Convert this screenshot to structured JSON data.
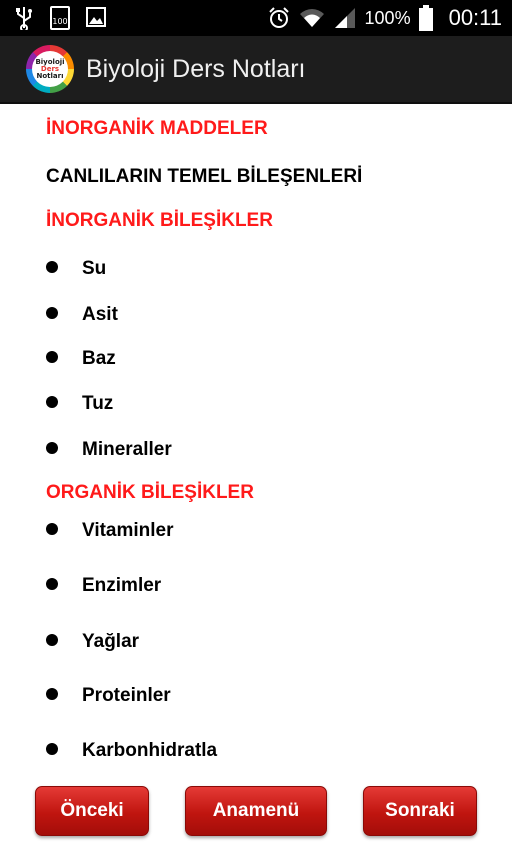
{
  "status_bar": {
    "battery_icon_text": "100",
    "battery_percent": "100%",
    "time": "00:11",
    "icons": [
      "usb-icon",
      "battery-level-icon",
      "image-icon",
      "alarm-icon",
      "wifi-icon",
      "signal-icon",
      "battery-icon"
    ]
  },
  "app_bar": {
    "title": "Biyoloji Ders Notları",
    "logo_lines": [
      "Biyoloji",
      "Ders",
      "Notları"
    ]
  },
  "content": {
    "heading_1": "İNORGANİK MADDELER",
    "subheading": "CANLILARIN TEMEL BİLEŞENLERİ",
    "heading_2": "İNORGANİK BİLEŞİKLER",
    "inorganic_items": [
      "Su",
      "Asit",
      "Baz",
      "Tuz",
      "Mineraller"
    ],
    "heading_3": "ORGANİK BİLEŞİKLER",
    "organic_items": [
      "Vitaminler",
      "Enzimler",
      "Yağlar",
      "Proteinler",
      "Karbonhidratla"
    ]
  },
  "buttons": {
    "prev": "Önceki",
    "home": "Anamenü",
    "next": "Sonraki"
  },
  "colors": {
    "heading_red": "#ff1a1a",
    "button_red": "#c0150f",
    "action_bar": "#1d1d1d"
  }
}
